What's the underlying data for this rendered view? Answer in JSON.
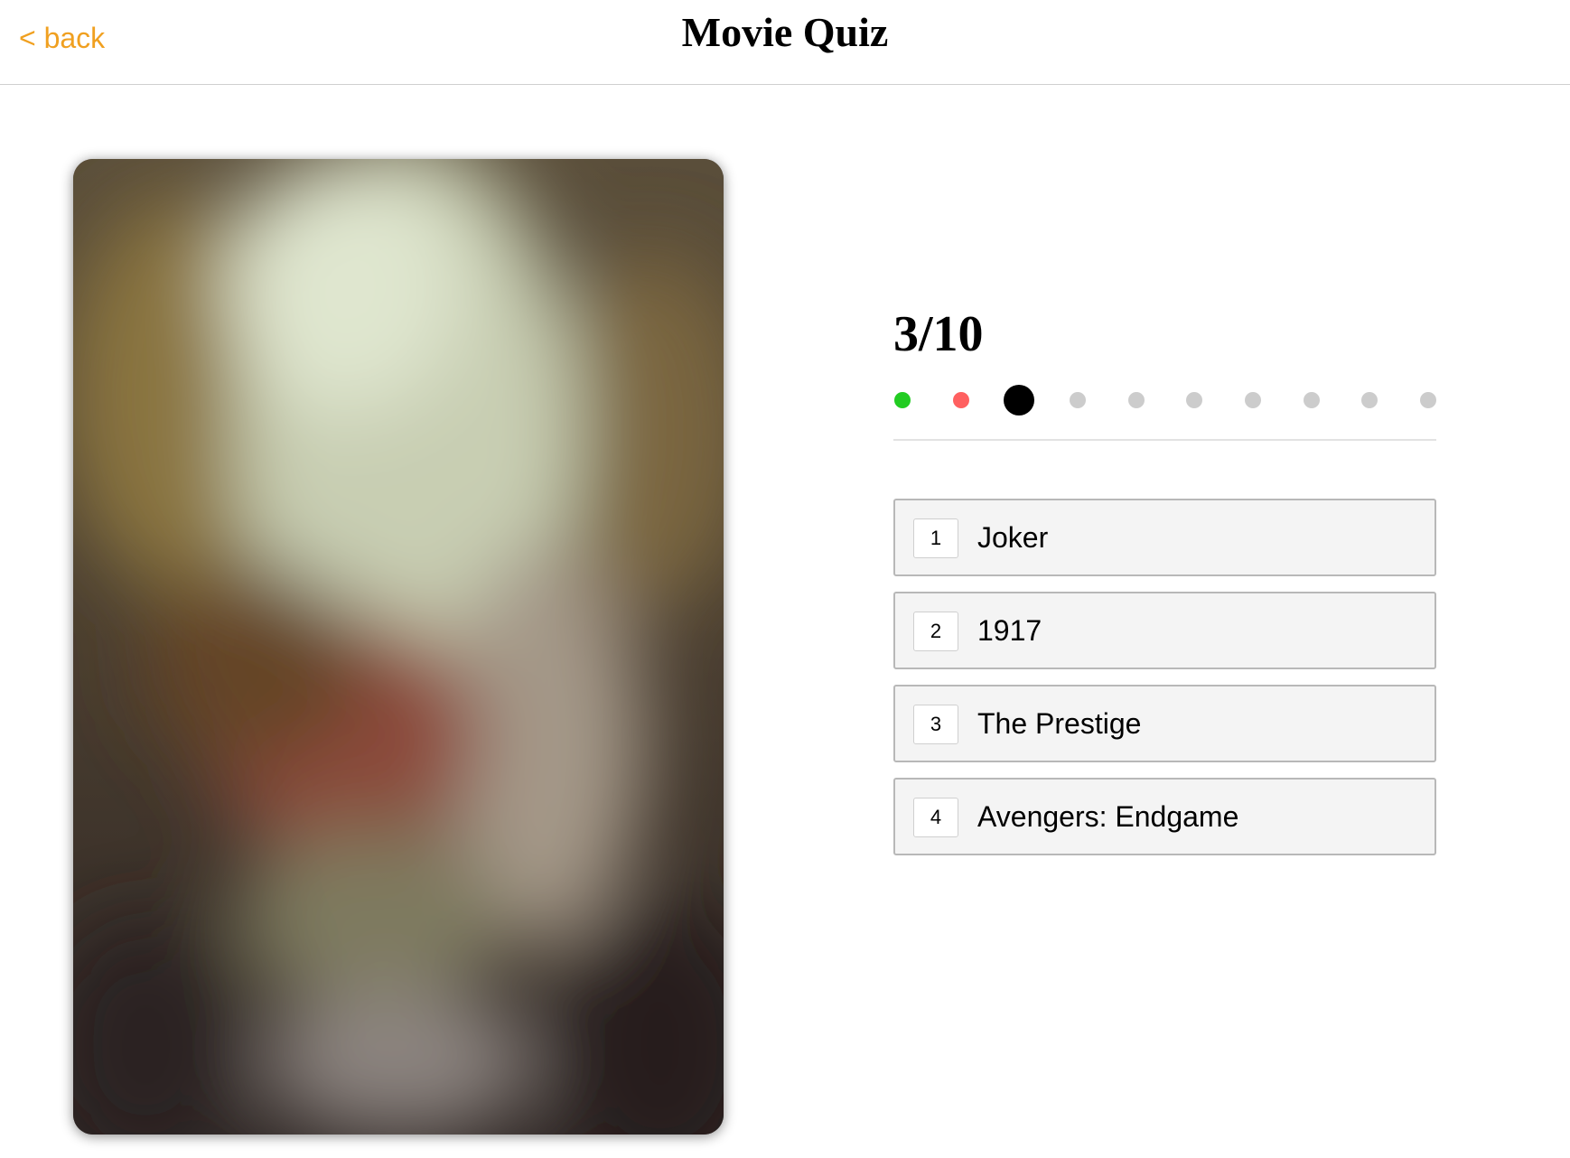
{
  "header": {
    "back_label": "< back",
    "title": "Movie Quiz"
  },
  "poster": {
    "description_icon": "blurred-movie-poster"
  },
  "quiz": {
    "counter": "3/10",
    "current_question": 3,
    "total_questions": 10,
    "progress": [
      "correct",
      "wrong",
      "current",
      "pending",
      "pending",
      "pending",
      "pending",
      "pending",
      "pending",
      "pending"
    ],
    "status_colors": {
      "correct": "#22cc22",
      "wrong": "#ff6060",
      "current": "#000000",
      "pending": "#cccccc"
    },
    "options": [
      {
        "key": "1",
        "label": "Joker"
      },
      {
        "key": "2",
        "label": "1917"
      },
      {
        "key": "3",
        "label": "The Prestige"
      },
      {
        "key": "4",
        "label": "Avengers: Endgame"
      }
    ]
  },
  "colors": {
    "accent": "#f0a020"
  }
}
